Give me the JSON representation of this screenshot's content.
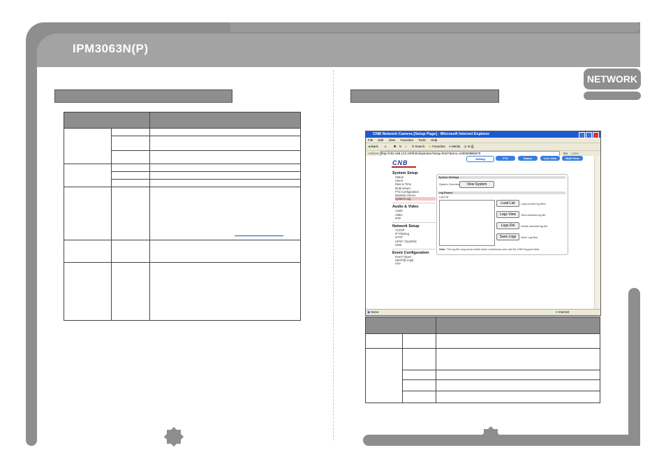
{
  "header": {
    "title": "IPM3063N(P)",
    "section_badge": "NETWORK"
  },
  "browser": {
    "window_title": "CNB Network Camera [Setup Page] - Microsoft Internet Explorer",
    "menu": [
      "File",
      "Edit",
      "View",
      "Favorites",
      "Tools",
      "Help"
    ],
    "toolbar": {
      "back": "Back",
      "search": "Search",
      "favorites": "Favorites",
      "media": "Media"
    },
    "address_label": "Address",
    "address_value": "http://192.168.123.100/html/operator/Setup.html?demo=1200008B5670",
    "go": "Go",
    "links": "Links",
    "status_left": "Done",
    "status_right": "Internet"
  },
  "page": {
    "logo": "CNB",
    "tabs": [
      "Setting",
      "PTZ",
      "Status",
      "Live View",
      "Multi View"
    ],
    "nav": [
      {
        "heading": "System Setup",
        "items": [
          "Status",
          "Users",
          "Date & Time",
          "Multi viewer",
          "PTZ Configuration",
          "Maintain Server",
          "System Log"
        ]
      },
      {
        "heading": "Audio & Video",
        "items": [
          "Audio",
          "Video",
          "RTP"
        ]
      },
      {
        "heading": "Network Setup",
        "items": [
          "TCP/IP",
          "IP Filtering",
          "HTTP",
          "UPnP / DynDNS",
          "CMS"
        ]
      },
      {
        "heading": "Event Configuration",
        "items": [
          "Event Types",
          "SMTP(E-mail)",
          "FTP"
        ]
      }
    ],
    "system_settings_header": "System Settings",
    "system_overview_label": "System Overview",
    "view_system_button": "View System",
    "log_report_header": "Log Report",
    "log_list_label": "Log List",
    "buttons": [
      {
        "label": "Load List",
        "desc": "Load current log files."
      },
      {
        "label": "Logs View",
        "desc": "View selected log file."
      },
      {
        "label": "Logs Del",
        "desc": "Delete selected log file."
      },
      {
        "label": "Save Logs",
        "desc": "Save Log files."
      }
    ],
    "note_label": "Note:",
    "note_text": "The log file may prove useful when unanimous user ask the CNB Support desk."
  }
}
